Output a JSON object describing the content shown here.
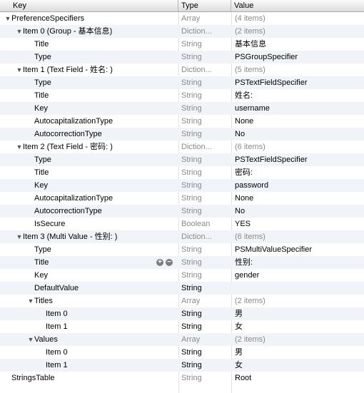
{
  "columns": {
    "key": "Key",
    "type": "Type",
    "value": "Value"
  },
  "rows": [
    {
      "indent": 0,
      "tri": true,
      "key": "PreferenceSpecifiers",
      "type": "Array",
      "type_dark": false,
      "value": "(4 items)",
      "value_gray": true
    },
    {
      "indent": 1,
      "tri": true,
      "key": "Item 0 (Group - 基本信息)",
      "type": "Diction...",
      "type_dark": false,
      "value": "(2 items)",
      "value_gray": true
    },
    {
      "indent": 2,
      "tri": false,
      "key": "Title",
      "type": "String",
      "type_dark": false,
      "value": "基本信息",
      "value_gray": false
    },
    {
      "indent": 2,
      "tri": false,
      "key": "Type",
      "type": "String",
      "type_dark": false,
      "value": "PSGroupSpecifier",
      "value_gray": false
    },
    {
      "indent": 1,
      "tri": true,
      "key": "Item 1 (Text Field - 姓名: )",
      "type": "Diction...",
      "type_dark": false,
      "value": "(5 items)",
      "value_gray": true
    },
    {
      "indent": 2,
      "tri": false,
      "key": "Type",
      "type": "String",
      "type_dark": false,
      "value": "PSTextFieldSpecifier",
      "value_gray": false
    },
    {
      "indent": 2,
      "tri": false,
      "key": "Title",
      "type": "String",
      "type_dark": false,
      "value": "姓名:",
      "value_gray": false
    },
    {
      "indent": 2,
      "tri": false,
      "key": "Key",
      "type": "String",
      "type_dark": false,
      "value": "username",
      "value_gray": false
    },
    {
      "indent": 2,
      "tri": false,
      "key": "AutocapitalizationType",
      "type": "String",
      "type_dark": false,
      "value": "None",
      "value_gray": false
    },
    {
      "indent": 2,
      "tri": false,
      "key": "AutocorrectionType",
      "type": "String",
      "type_dark": false,
      "value": "No",
      "value_gray": false
    },
    {
      "indent": 1,
      "tri": true,
      "key": "Item 2 (Text Field - 密码: )",
      "type": "Diction...",
      "type_dark": false,
      "value": "(6 items)",
      "value_gray": true
    },
    {
      "indent": 2,
      "tri": false,
      "key": "Type",
      "type": "String",
      "type_dark": false,
      "value": "PSTextFieldSpecifier",
      "value_gray": false
    },
    {
      "indent": 2,
      "tri": false,
      "key": "Title",
      "type": "String",
      "type_dark": false,
      "value": "密码:",
      "value_gray": false
    },
    {
      "indent": 2,
      "tri": false,
      "key": "Key",
      "type": "String",
      "type_dark": false,
      "value": "password",
      "value_gray": false
    },
    {
      "indent": 2,
      "tri": false,
      "key": "AutocapitalizationType",
      "type": "String",
      "type_dark": false,
      "value": "None",
      "value_gray": false
    },
    {
      "indent": 2,
      "tri": false,
      "key": "AutocorrectionType",
      "type": "String",
      "type_dark": false,
      "value": "No",
      "value_gray": false
    },
    {
      "indent": 2,
      "tri": false,
      "key": "IsSecure",
      "type": "Boolean",
      "type_dark": false,
      "value": "YES",
      "value_gray": false
    },
    {
      "indent": 1,
      "tri": true,
      "key": "Item 3 (Multi Value - 性别: )",
      "type": "Diction...",
      "type_dark": false,
      "value": "(6 items)",
      "value_gray": true
    },
    {
      "indent": 2,
      "tri": false,
      "key": "Type",
      "type": "String",
      "type_dark": false,
      "value": "PSMultiValueSpecifier",
      "value_gray": false
    },
    {
      "indent": 2,
      "tri": false,
      "key": "Title",
      "type": "String",
      "type_dark": false,
      "value": "性别:",
      "value_gray": false,
      "controls": true
    },
    {
      "indent": 2,
      "tri": false,
      "key": "Key",
      "type": "String",
      "type_dark": false,
      "value": "gender",
      "value_gray": false
    },
    {
      "indent": 2,
      "tri": false,
      "key": "DefaultValue",
      "type": "String",
      "type_dark": true,
      "value": "",
      "value_gray": false
    },
    {
      "indent": 2,
      "tri": true,
      "key": "Titles",
      "type": "Array",
      "type_dark": false,
      "value": "(2 items)",
      "value_gray": true
    },
    {
      "indent": 3,
      "tri": false,
      "key": "Item 0",
      "type": "String",
      "type_dark": true,
      "value": "男",
      "value_gray": false
    },
    {
      "indent": 3,
      "tri": false,
      "key": "Item 1",
      "type": "String",
      "type_dark": true,
      "value": "女",
      "value_gray": false
    },
    {
      "indent": 2,
      "tri": true,
      "key": "Values",
      "type": "Array",
      "type_dark": false,
      "value": "(2 items)",
      "value_gray": true
    },
    {
      "indent": 3,
      "tri": false,
      "key": "Item 0",
      "type": "String",
      "type_dark": true,
      "value": "男",
      "value_gray": false
    },
    {
      "indent": 3,
      "tri": false,
      "key": "Item 1",
      "type": "String",
      "type_dark": true,
      "value": "女",
      "value_gray": false
    },
    {
      "indent": 0,
      "tri": false,
      "key": "StringsTable",
      "type": "String",
      "type_dark": false,
      "value": "Root",
      "value_gray": false
    }
  ],
  "icons": {
    "disclosure": "disclosure-triangle-icon",
    "add": "add-row-icon",
    "remove": "remove-row-icon"
  },
  "colors": {
    "stripe": "#f0f3f8",
    "muted": "#8a8a8a"
  }
}
